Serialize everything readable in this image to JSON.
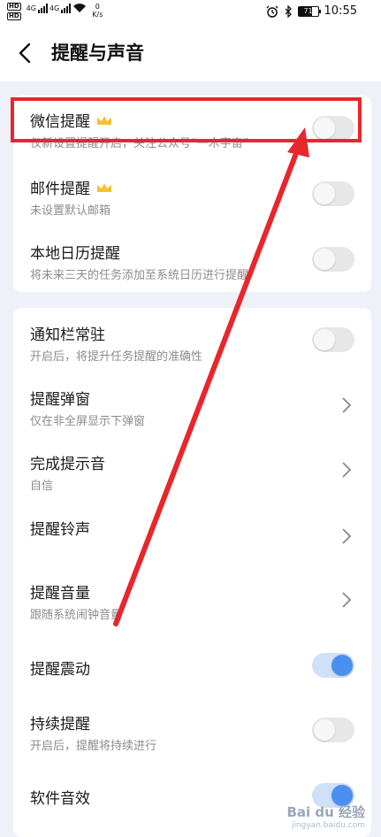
{
  "status": {
    "hd1": "HD",
    "hd2": "HD",
    "sig1": "4G",
    "sig2": "4G",
    "speed_value": "0",
    "speed_unit": "K/s",
    "battery": "71",
    "battery_level": 0.71,
    "time": "10:55"
  },
  "header": {
    "title": "提醒与声音"
  },
  "card1": {
    "items": [
      {
        "title": "微信提醒",
        "subtitle": "仅新设置提醒开启，关注公众号“一木宇宙”",
        "premium": true,
        "on": false
      },
      {
        "title": "邮件提醒",
        "subtitle": "未设置默认邮箱",
        "premium": true,
        "on": false
      },
      {
        "title": "本地日历提醒",
        "subtitle": "将未来三天的任务添加至系统日历进行提醒",
        "premium": false,
        "on": false
      }
    ]
  },
  "card2": {
    "items": [
      {
        "title": "通知栏常驻",
        "subtitle": "开启后，将提升任务提醒的准确性",
        "control": "toggle",
        "on": false
      },
      {
        "title": "提醒弹窗",
        "subtitle": "仅在非全屏显示下弹窗",
        "control": "chevron"
      },
      {
        "title": "完成提示音",
        "subtitle": "自信",
        "control": "chevron"
      },
      {
        "title": "提醒铃声",
        "subtitle": "",
        "control": "chevron"
      },
      {
        "title": "提醒音量",
        "subtitle": "跟随系统闹钟音量",
        "control": "chevron"
      },
      {
        "title": "提醒震动",
        "subtitle": "",
        "control": "toggle",
        "on": true
      },
      {
        "title": "持续提醒",
        "subtitle": "开启后，提醒将持续进行",
        "control": "toggle",
        "on": false
      },
      {
        "title": "软件音效",
        "subtitle": "",
        "control": "toggle",
        "on": true
      }
    ]
  },
  "colors": {
    "accent": "#4b8ff0",
    "annotation": "#e8262b",
    "crown": "#f2c230"
  },
  "watermark": {
    "main": "Bai du 经验",
    "sub": "jingyan.baidu.com"
  }
}
